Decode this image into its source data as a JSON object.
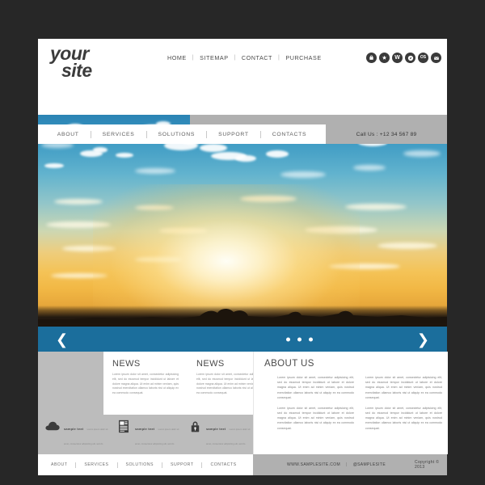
{
  "page": {
    "background_color": "#272727",
    "sheet_color": "#ffffff",
    "accent_blue": "#1b6e9c",
    "grey_panel": "#bcbcbc",
    "grey_band": "#b0b0b0"
  },
  "header": {
    "logo_line1": "your",
    "logo_line2": "site",
    "topnav": [
      {
        "label": "HOME"
      },
      {
        "label": "SITEMAP"
      },
      {
        "label": "CONTACT"
      },
      {
        "label": "PURCHASE"
      }
    ],
    "topnav_separator": "|",
    "social_icons": [
      {
        "name": "bag-icon",
        "glyph": ""
      },
      {
        "name": "star-icon",
        "glyph": "★"
      },
      {
        "name": "wordpress-icon",
        "glyph": "W"
      },
      {
        "name": "compass-icon",
        "glyph": ""
      },
      {
        "name": "os-icon",
        "glyph": "OS"
      },
      {
        "name": "envelope-icon",
        "glyph": "✉"
      }
    ]
  },
  "mainnav": {
    "items": [
      {
        "label": "ABOUT"
      },
      {
        "label": "SERVICES"
      },
      {
        "label": "SOLUTIONS"
      },
      {
        "label": "SUPPORT"
      },
      {
        "label": "CONTACTS"
      }
    ],
    "call_us": "Call Us : +12 34 567 89"
  },
  "slider": {
    "prev_glyph": "❮",
    "next_glyph": "❯",
    "dot_count": 3,
    "active_dot": 0
  },
  "news": {
    "columns": [
      {
        "heading": "NEWS",
        "body": "Lorem ipsum dolor sit amet, consectetur adipisicing elit, sed do eiusmod tempor incididunt ut labore et dolore magna aliqua. Ut enim ad minim veniam, quis nostrud exercitation ullamco laboris nisi ut aliquip ex ea commodo consequat."
      },
      {
        "heading": "NEWS",
        "body": "Lorem ipsum dolor sit amet, consectetur adipisicing elit, sed do eiusmod tempor incididunt ut labore et dolore magna aliqua. Ut enim ad minim veniam, quis nostrud exercitation ullamco laboris nisi ut aliquip ex ea commodo consequat."
      }
    ]
  },
  "about": {
    "heading": "ABOUT US",
    "col1_p1": "Lorem ipsum dolor sit amet, consectetur adipisicing elit, sed do eiusmod tempor incididunt ut labore et dolore magna aliqua. Ut enim ad minim veniam, quis nostrud exercitation ullamco laboris nisi ut aliquip ex ea commodo consequat.",
    "col1_p2": "Lorem ipsum dolor sit amet, consectetur adipisicing elit, sed do eiusmod tempor incididunt ut labore et dolore magna aliqua. Ut enim ad minim veniam, quis nostrud exercitation ullamco laboris nisi ut aliquip ex ea commodo consequat.",
    "col2_p1": "Lorem ipsum dolor sit amet, consectetur adipisicing elit, sed do eiusmod tempor incididunt ut labore et dolore magna aliqua. Ut enim ad minim veniam, quis nostrud exercitation ullamco laboris nisi ut aliquip ex ea commodo consequat.",
    "col2_p2": "Lorem ipsum dolor sit amet, consectetur adipisicing elit, sed do eiusmod tempor incididunt ut labore et dolore magna aliqua. Ut enim ad minim veniam, quis nostrud exercitation ullamco laboris nisi ut aliquip ex ea commodo consequat."
  },
  "features": [
    {
      "icon": "cloud-icon",
      "heading": "sample text",
      "body": "Lorem ipsum dolor sit amet, consectetur adipisicing elit, sed do eiusmod tempor incididunt ut labore et dolore magna aliqua."
    },
    {
      "icon": "newspaper-icon",
      "heading": "sample text",
      "body": "Lorem ipsum dolor sit amet, consectetur adipisicing elit, sed do eiusmod tempor incididunt ut labore et dolore magna aliqua."
    },
    {
      "icon": "lock-icon",
      "heading": "sample text",
      "body": "Lorem ipsum dolor sit amet, consectetur adipisicing elit, sed do eiusmod tempor incididunt ut labore et dolore magna aliqua."
    }
  ],
  "footer": {
    "links": [
      {
        "label": "ABOUT"
      },
      {
        "label": "SERVICES"
      },
      {
        "label": "SOLUTIONS"
      },
      {
        "label": "SUPPORT"
      },
      {
        "label": "CONTACTS"
      }
    ],
    "site_url": "WWW.SAMPLESITE.COM",
    "separator": "|",
    "social_handle": "@SAMPLESITE",
    "copyright": "Copyright © 2013"
  }
}
